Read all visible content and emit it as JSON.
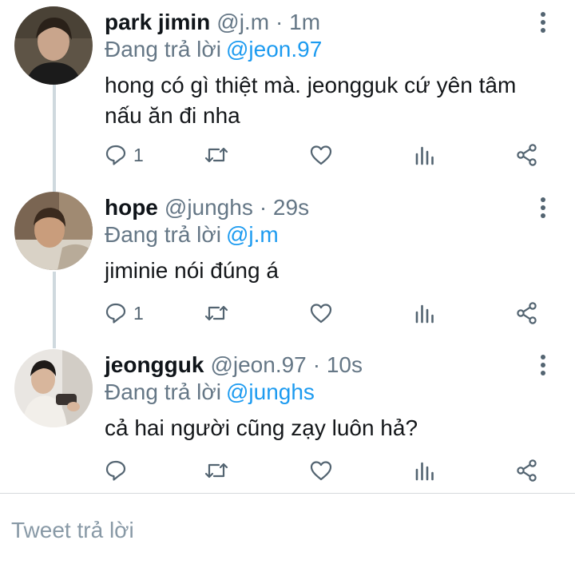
{
  "tweets": [
    {
      "name": "park jimin",
      "handle": "@j.m",
      "time": "· 1m",
      "replying_label": "Đang trả lời",
      "replying_to": "@jeon.97",
      "content": "hong có gì thiệt mà. jeongguk cứ yên tâm nấu ăn đi nha",
      "reply_count": "1",
      "avatar_colors": {
        "bg": "#5e5446",
        "hair": "#2a2119",
        "skin": "#c9a58c",
        "cloth": "#1b1b1b"
      }
    },
    {
      "name": "hope",
      "handle": "@junghs",
      "time": "· 29s",
      "replying_label": "Đang trả lời",
      "replying_to": "@j.m",
      "content": "jiminie nói đúng á",
      "reply_count": "1",
      "avatar_colors": {
        "bg": "#7a6552",
        "hair": "#3a2a1e",
        "skin": "#c99d7c",
        "cloth": "#d9d2c6"
      }
    },
    {
      "name": "jeongguk",
      "handle": "@jeon.97",
      "time": "· 10s",
      "replying_label": "Đang trả lời",
      "replying_to": "@junghs",
      "content": "cả hai người cũng zạy luôn hả?",
      "reply_count": "",
      "avatar_colors": {
        "bg": "#e9e6e2",
        "hair": "#1e1a18",
        "skin": "#d8b69c",
        "cloth": "#f2efea"
      }
    }
  ],
  "icons": {
    "reply": "reply-icon",
    "retweet": "retweet-icon",
    "like": "heart-icon",
    "analytics": "analytics-icon",
    "share": "share-icon",
    "more": "more-vertical-icon"
  },
  "reply_box": {
    "placeholder": "Tweet trả lời"
  },
  "colors": {
    "link": "#1d9bf0",
    "secondary": "#657786",
    "icon": "#536471",
    "thread_line": "#cfd9de"
  }
}
